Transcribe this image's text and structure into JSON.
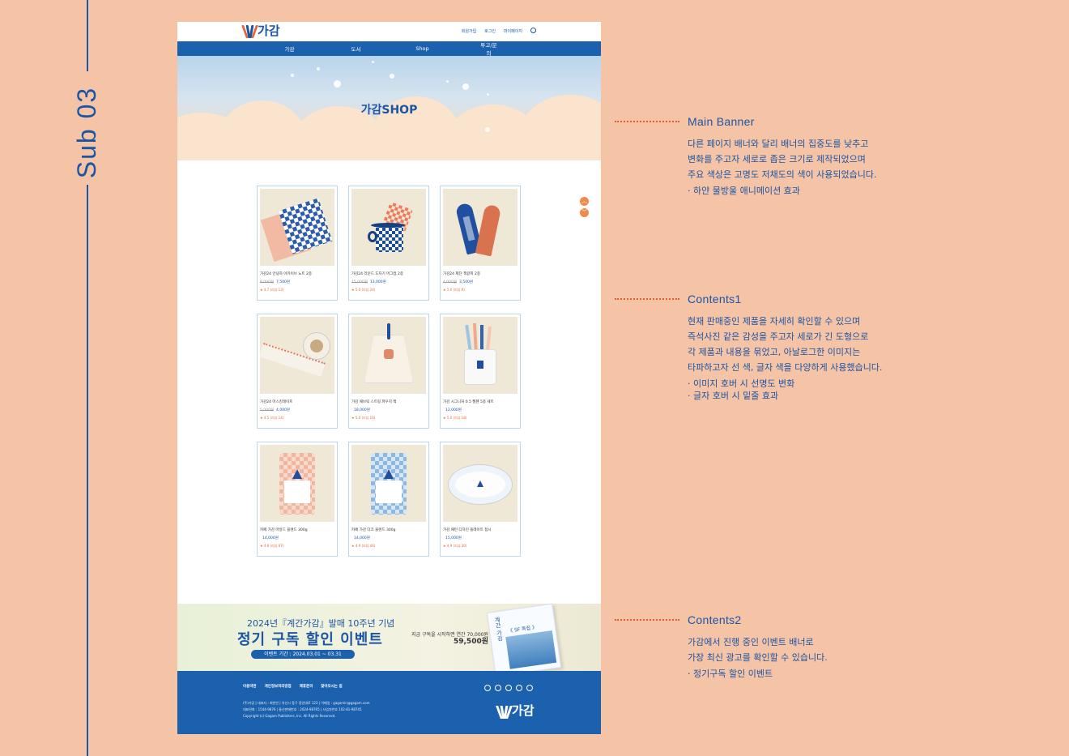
{
  "side": {
    "label": "Sub 03"
  },
  "site": {
    "logo_text": "가감",
    "util": [
      "회원가입",
      "로그인",
      "마이페이지"
    ],
    "nav": [
      "가감",
      "도서",
      "Shop",
      "투고/문의"
    ],
    "banner_title": "가감SHOP",
    "products": [
      {
        "name": "가감24 안녕하 아카이브 노트 2종",
        "old": "8,000원",
        "price": "7,500원",
        "rate": "★ 4.7 (리뷰 13)"
      },
      {
        "name": "가감24 라운드 도자기 머그컵 2종",
        "old": "15,000원",
        "price": "13,000원",
        "rate": "★ 5.0 (리뷰 24)"
      },
      {
        "name": "가감24 제단 책갈피 2종",
        "old": "4,000원",
        "price": "3,500원",
        "rate": "★ 5.0 (리뷰 8)"
      },
      {
        "name": "가감24 마스킹테이프",
        "old": "5,000원",
        "price": "4,000원",
        "rate": "★ 4.5 (리뷰 14)"
      },
      {
        "name": "가감 패브릭 스트링 파우치 백",
        "old": "",
        "price": "18,000원",
        "rate": "★ 5.0 (리뷰 16)"
      },
      {
        "name": "가감 시그니처 0.5 젤펜 5종 세트",
        "old": "",
        "price": "12,000원",
        "rate": "★ 5.0 (리뷰 18)"
      },
      {
        "name": "카페 가감 마일드 블렌드 300g",
        "old": "",
        "price": "14,000원",
        "rate": "★ 4.8 (리뷰 67)"
      },
      {
        "name": "카페 가감 다크 블렌드 300g",
        "old": "",
        "price": "14,000원",
        "rate": "★ 4.9 (리뷰 46)"
      },
      {
        "name": "가감 패턴 디자인 플레이트 접시",
        "old": "",
        "price": "15,000원",
        "rate": "★ 4.9 (리뷰 30)"
      }
    ],
    "event": {
      "line1": "2024년『계간가감』발매 10주년 기념",
      "line2": "정기 구독 할인 이벤트",
      "period": "이벤트 기간 : 2024.03.01 ~ 03.31",
      "promo1": "지금 구독을 시작하면 연간 70,000원",
      "promo2": "59,500원",
      "mag_title": "계간 가감",
      "mag_sub": "《 SF 특집 》"
    },
    "footer": {
      "links": [
        "이용약관",
        "개인정보처리방침",
        "제휴문의",
        "찾아오시는 길"
      ],
      "info1": "(주)가감 | 대표자 : 최한빈 | 유선시 중구 중앙대로 123 | 이메일 : gagamin@gagam.com",
      "info2": "대표전화 : 1544-9876 | 통신판매번호 : 2024-98765 | 사업자번호 102-81-98745",
      "copyright": "Copyright (c) Gagam Publishers, Inc. All Rights Reserved.",
      "logo_text": "가감"
    }
  },
  "annotations": [
    {
      "title": "Main Banner",
      "lines": [
        "다른 페이지 배너와 달리 배너의 집중도를 낮추고",
        "변화를 주고자 세로로 좁은 크기로 제작되었으며",
        "주요 색상은 고명도 저채도의 색이 사용되었습니다."
      ],
      "bullets": [
        "· 하얀 물방울 애니메이션 효과"
      ]
    },
    {
      "title": "Contents1",
      "lines": [
        "현재 판매중인 제품을 자세히 확인할 수 있으며",
        "즉석사진 같은 감성을 주고자 세로가 긴 도형으로",
        "각 제품과 내용을 묶었고, 아날로그한 이미지는",
        "타파하고자 선 색, 글자 색을 다양하게 사용했습니다."
      ],
      "bullets": [
        "· 이미지 호버 시 선명도 변화",
        "· 글자 호버 시 밑줄 효과"
      ]
    },
    {
      "title": "Contents2",
      "lines": [
        "가감에서 진행 중인 이벤트 배너로",
        "가장 최신 광고를 확인할 수 있습니다."
      ],
      "bullets": [
        "· 정기구독 할인 이벤트"
      ]
    }
  ]
}
